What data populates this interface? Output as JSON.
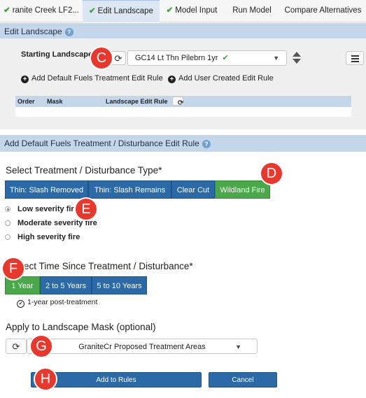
{
  "tabs": [
    {
      "label": "ranite Creek LF2...",
      "checked": true,
      "active": false
    },
    {
      "label": "Edit Landscape",
      "checked": true,
      "active": true
    },
    {
      "label": "Model Input",
      "checked": true,
      "active": false
    },
    {
      "label": "Run Model",
      "checked": false,
      "active": false
    },
    {
      "label": "Compare Alternatives",
      "checked": false,
      "active": false
    }
  ],
  "edit_landscape": {
    "header": "Edit Landscape",
    "starting_landscape_label": "Starting Landscape*",
    "starting_landscape_value": "GC14  Lt  Thn  Pilebrn  1yr",
    "add_default_rule": "Add Default Fuels Treatment Edit Rule",
    "add_user_rule": "Add User Created Edit Rule",
    "table_headers": {
      "order": "Order",
      "mask": "Mask",
      "rule": "Landscape Edit Rule"
    }
  },
  "add_rule": {
    "header": "Add Default Fuels Treatment / Disturbance Edit Rule",
    "treatment_type_title": "Select Treatment / Disturbance Type*",
    "treatment_buttons": [
      {
        "label": "Thin: Slash Removed",
        "selected": false
      },
      {
        "label": "Thin: Slash Remains",
        "selected": false
      },
      {
        "label": "Clear Cut",
        "selected": false
      },
      {
        "label": "Wildland Fire",
        "selected": true
      }
    ],
    "severity_options": [
      {
        "label": "Low severity fire",
        "selected": true
      },
      {
        "label": "Moderate severity fire",
        "selected": false
      },
      {
        "label": "High severity fire",
        "selected": false
      }
    ],
    "time_title": "ect Time Since Treatment / Disturbance*",
    "time_buttons": [
      {
        "label": "1 Year",
        "selected": true
      },
      {
        "label": "2 to 5 Years",
        "selected": false
      },
      {
        "label": "5 to 10 Years",
        "selected": false
      }
    ],
    "time_note": "1-year post-treatment",
    "mask_title": "Apply to Landscape Mask (optional)",
    "mask_value": "GraniteCr Proposed Treatment Areas",
    "add_button": "Add to Rules",
    "cancel_button": "Cancel"
  },
  "markers": [
    "C",
    "D",
    "E",
    "F",
    "G",
    "H"
  ],
  "colors": {
    "accent_blue": "#2b6aa6",
    "selected_green": "#4aa84a",
    "header_band": "#c5d6ea",
    "marker_red": "#e8372c"
  },
  "icons": {
    "check": "✔",
    "refresh": "⟳",
    "caret": "▼"
  }
}
